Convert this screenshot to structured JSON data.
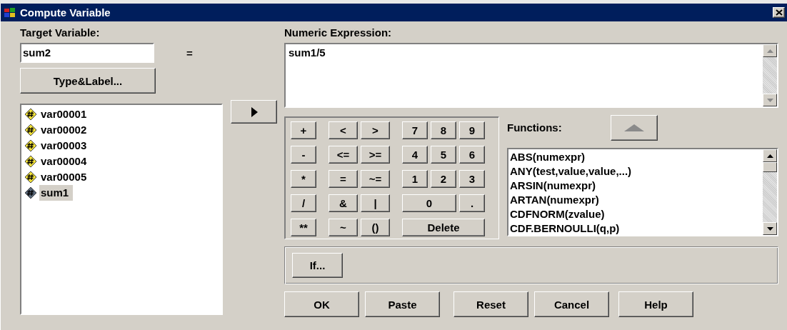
{
  "window": {
    "title": "Compute Variable"
  },
  "target": {
    "label": "Target Variable:",
    "value": "sum2",
    "equals": "="
  },
  "type_label_button": "Type&Label...",
  "variables": [
    {
      "name": "var00001",
      "color": "#f2e23a",
      "selected": false
    },
    {
      "name": "var00002",
      "color": "#f2e23a",
      "selected": false
    },
    {
      "name": "var00003",
      "color": "#f2e23a",
      "selected": false
    },
    {
      "name": "var00004",
      "color": "#f2e23a",
      "selected": false
    },
    {
      "name": "var00005",
      "color": "#f2e23a",
      "selected": false
    },
    {
      "name": "sum1",
      "color": "#5c6b7d",
      "selected": true
    }
  ],
  "expression": {
    "label": "Numeric Expression:",
    "value": "sum1/5"
  },
  "keypad": [
    {
      "operator": "+",
      "relations": [
        "<",
        ">"
      ],
      "digits": [
        "7",
        "8",
        "9"
      ]
    },
    {
      "operator": "-",
      "relations": [
        "<=",
        ">="
      ],
      "digits": [
        "4",
        "5",
        "6"
      ]
    },
    {
      "operator": "*",
      "relations": [
        "=",
        "~="
      ],
      "digits": [
        "1",
        "2",
        "3"
      ]
    },
    {
      "operator": "/",
      "relations": [
        "&",
        "|"
      ],
      "digits": [
        "0",
        "."
      ]
    },
    {
      "operator": "**",
      "relations": [
        "~",
        "()"
      ],
      "digits": [
        "Delete"
      ]
    }
  ],
  "functions": {
    "label": "Functions:",
    "items": [
      "ABS(numexpr)",
      "ANY(test,value,value,...)",
      "ARSIN(numexpr)",
      "ARTAN(numexpr)",
      "CDFNORM(zvalue)",
      "CDF.BERNOULLI(q,p)"
    ]
  },
  "if_button": "If...",
  "buttons": [
    "OK",
    "Paste",
    "Reset",
    "Cancel",
    "Help"
  ]
}
